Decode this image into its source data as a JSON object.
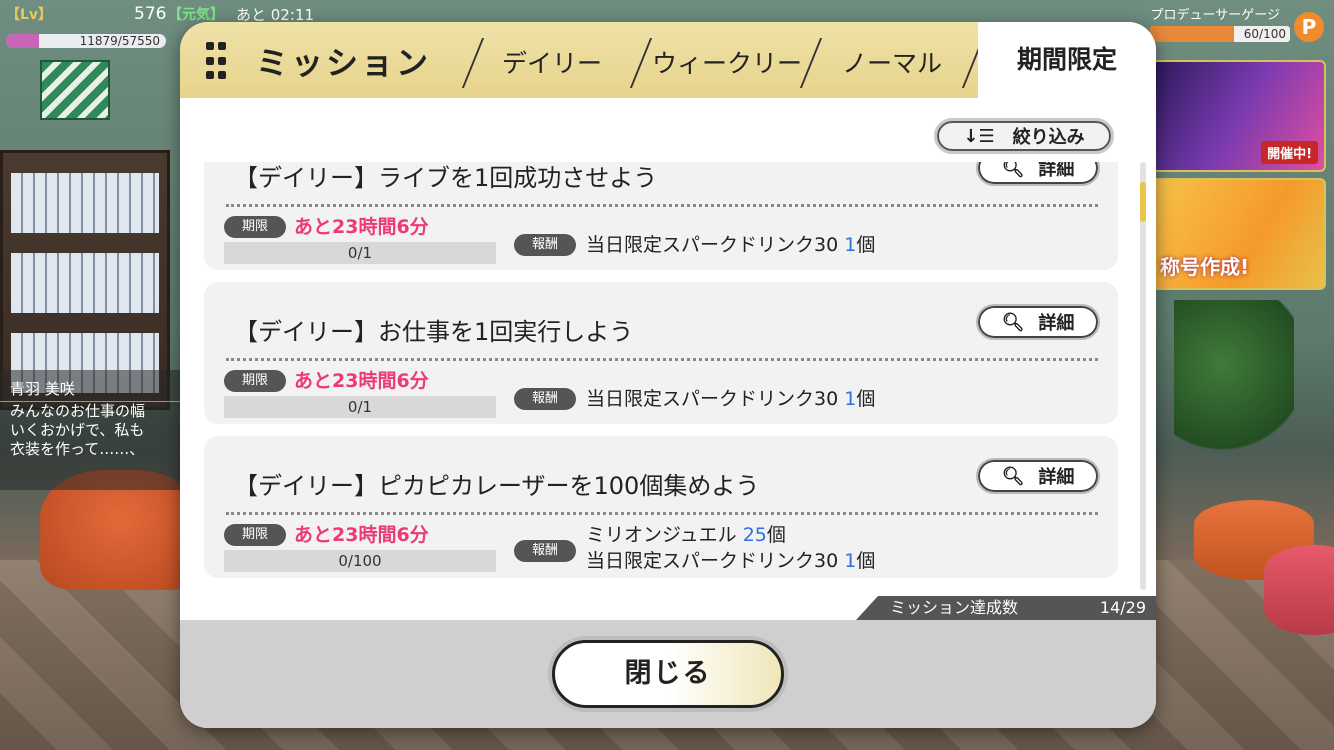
{
  "hud": {
    "lv_tag": "【Lv】",
    "level": "576",
    "exp": "11879/57550",
    "exp_progress": 0.206,
    "genki_tag": "【元気】",
    "time_left": "あと 02:11"
  },
  "producer_gauge": {
    "label": "プロデューサーゲージ",
    "value": "60/100",
    "progress": 0.6,
    "badge": "P"
  },
  "banners": [
    {
      "name": "evolution-banner",
      "tag": "開催中!"
    },
    {
      "name": "anniversary-banner",
      "tag": "称号作成!"
    }
  ],
  "dialogue": {
    "name": "青羽 美咲",
    "lines": [
      "みんなのお仕事の幅",
      "いくおかげで、私も",
      "衣装を作って……、"
    ]
  },
  "modal": {
    "title": "ミッション",
    "tabs": {
      "daily": "デイリー",
      "weekly": "ウィークリー",
      "normal": "ノーマル",
      "limited": "期間限定"
    },
    "active_tab": "limited",
    "filter_label": "絞り込み",
    "detail_label": "詳細",
    "deadline_label": "期限",
    "reward_label": "報酬",
    "missions": [
      {
        "title": "【デイリー】ライブを1回成功させよう",
        "deadline": "あと23時間6分",
        "progress_text": "0/1",
        "progress": 0,
        "rewards": [
          {
            "item": "当日限定スパークドリンク30 ",
            "qty": "1",
            "unit": "個"
          }
        ]
      },
      {
        "title": "【デイリー】お仕事を1回実行しよう",
        "deadline": "あと23時間6分",
        "progress_text": "0/1",
        "progress": 0,
        "rewards": [
          {
            "item": "当日限定スパークドリンク30 ",
            "qty": "1",
            "unit": "個"
          }
        ]
      },
      {
        "title": "【デイリー】ピカピカレーザーを100個集めよう",
        "deadline": "あと23時間6分",
        "progress_text": "0/100",
        "progress": 0,
        "rewards": [
          {
            "item": "ミリオンジュエル ",
            "qty": "25",
            "unit": "個"
          },
          {
            "item": "当日限定スパークドリンク30 ",
            "qty": "1",
            "unit": "個"
          }
        ]
      }
    ],
    "achievement_label": "ミッション達成数",
    "achievement_count": "14/29",
    "close_label": "閉じる"
  },
  "colors": {
    "header_bg": "#e7d48c",
    "deadline_text": "#ec3a78",
    "qty_text": "#2f6ee0",
    "progress_fill": "#e8893a"
  }
}
